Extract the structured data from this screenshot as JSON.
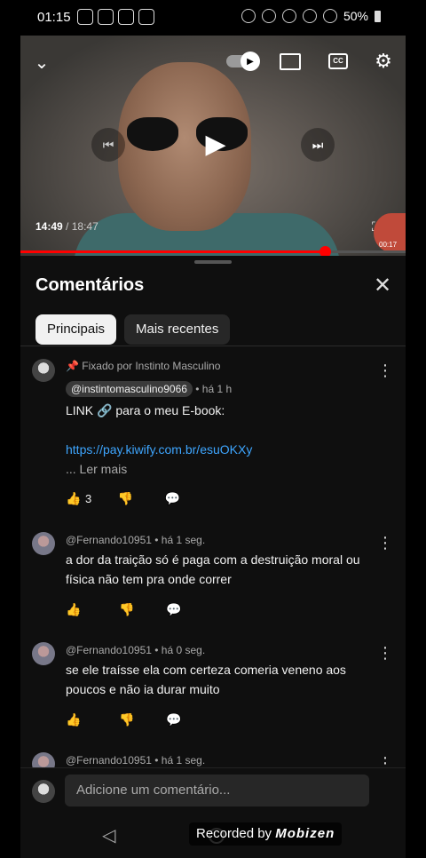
{
  "status_bar": {
    "time": "01:15",
    "battery": "50%"
  },
  "video": {
    "current_time": "14:49",
    "duration": "18:47",
    "mini_timer": "00:17",
    "progress_fraction": 0.79,
    "cc_label": "CC"
  },
  "comments": {
    "title": "Comentários",
    "tabs": [
      "Principais",
      "Mais recentes"
    ],
    "pinned": {
      "pinned_by": "Fixado por Instinto  Masculino",
      "handle": "@instintomasculino9066",
      "time": "• há 1 h",
      "text": "LINK 🔗 para o meu E-book:",
      "link": "https://pay.kiwify.com.br/esuOKXy",
      "read_more": "... Ler mais",
      "likes": "3"
    },
    "items": [
      {
        "author": "@Fernando10951",
        "time": "• há 1 seg.",
        "text": "a dor da traição só é paga com a destruição moral ou física não tem pra onde correr"
      },
      {
        "author": "@Fernando10951",
        "time": "• há 0 seg.",
        "text": "se ele traísse ela com certeza comeria veneno aos poucos e não ia durar muito"
      },
      {
        "author": "@Fernando10951",
        "time": "• há 1 seg."
      }
    ],
    "add_placeholder": "Adicione um comentário..."
  },
  "recorder": {
    "prefix": "Recorded by",
    "brand": "Mobizen"
  }
}
